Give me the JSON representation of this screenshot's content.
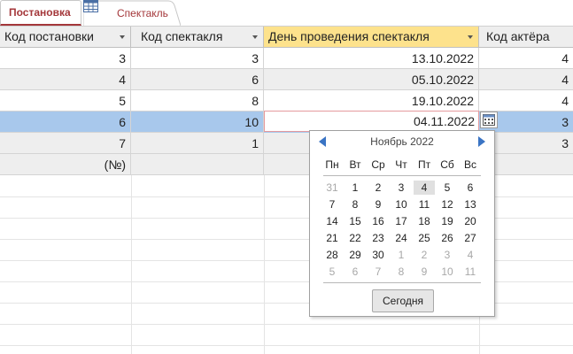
{
  "tabs": [
    {
      "label": "Постановка",
      "active": true
    },
    {
      "label": "Спектакль",
      "active": false,
      "icon": "table-icon"
    }
  ],
  "columns": [
    {
      "label": "Код постановки",
      "sorted": false
    },
    {
      "label": "Код спектакля",
      "sorted": false
    },
    {
      "label": "День проведения спектакля",
      "sorted": true
    },
    {
      "label": "Код актёра",
      "sorted": false
    }
  ],
  "rows": [
    {
      "c1": "3",
      "c2": "3",
      "c3": "13.10.2022",
      "c4": "4"
    },
    {
      "c1": "4",
      "c2": "6",
      "c3": "05.10.2022",
      "c4": "4"
    },
    {
      "c1": "5",
      "c2": "8",
      "c3": "19.10.2022",
      "c4": "4"
    },
    {
      "c1": "6",
      "c2": "10",
      "c3": "04.11.2022",
      "c4": "3"
    },
    {
      "c1": "7",
      "c2": "1",
      "c3": "",
      "c4": "3"
    }
  ],
  "new_row": {
    "c1": "(№)"
  },
  "calendar": {
    "month_label": "Ноябрь 2022",
    "weekdays": [
      "Пн",
      "Вт",
      "Ср",
      "Чт",
      "Пт",
      "Сб",
      "Вс"
    ],
    "weeks": [
      [
        "31",
        "1",
        "2",
        "3",
        "4",
        "5",
        "6"
      ],
      [
        "7",
        "8",
        "9",
        "10",
        "11",
        "12",
        "13"
      ],
      [
        "14",
        "15",
        "16",
        "17",
        "18",
        "19",
        "20"
      ],
      [
        "21",
        "22",
        "23",
        "24",
        "25",
        "26",
        "27"
      ],
      [
        "28",
        "29",
        "30",
        "1",
        "2",
        "3",
        "4"
      ],
      [
        "5",
        "6",
        "7",
        "8",
        "9",
        "10",
        "11"
      ]
    ],
    "today_label": "Сегодня",
    "selected_day": "4"
  },
  "colors": {
    "accent": "#a4373a",
    "header_sorted": "#fde28c",
    "row_selected": "#a8c8ec",
    "nav_arrow": "#3a74c4"
  }
}
